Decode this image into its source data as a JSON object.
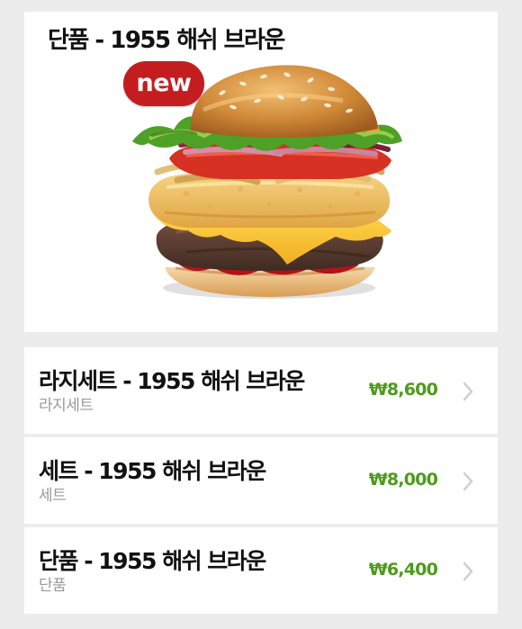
{
  "hero": {
    "title": "단품 - 1955 해쉬 브라운",
    "badge": "new",
    "image_icon": "burger-image",
    "badge_color": "#c41d20"
  },
  "options": [
    {
      "title": "라지세트 - 1955 해쉬 브라운",
      "subtitle": "라지세트",
      "price": "₩8,600",
      "icon": "chevron-right-icon"
    },
    {
      "title": "세트 - 1955 해쉬 브라운",
      "subtitle": "세트",
      "price": "₩8,000",
      "icon": "chevron-right-icon"
    },
    {
      "title": "단품 - 1955 해쉬 브라운",
      "subtitle": "단품",
      "price": "₩6,400",
      "icon": "chevron-right-icon"
    }
  ],
  "colors": {
    "background": "#ececec",
    "card": "#ffffff",
    "price": "#4d9b1c",
    "subtitle": "#9a9a9a",
    "title": "#111111"
  }
}
